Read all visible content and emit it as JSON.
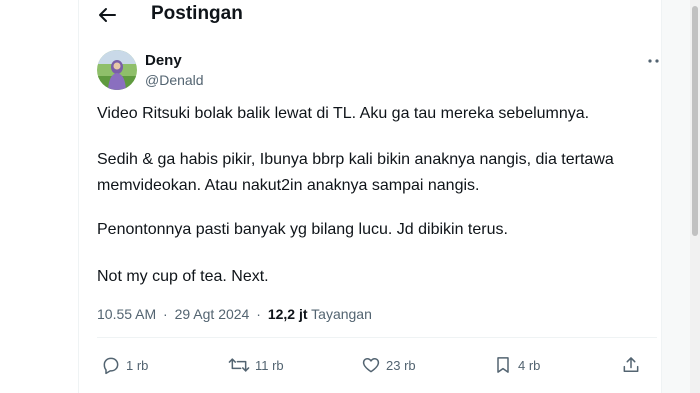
{
  "header": {
    "title": "Postingan"
  },
  "author": {
    "name": "Deny",
    "handle": "@Denald"
  },
  "tweet": {
    "paragraph1": "Video Ritsuki bolak balik lewat di TL. Aku ga tau mereka sebelumnya.",
    "paragraph2_line1": "Sedih & ga habis pikir, Ibunya bbrp kali bikin anaknya nangis, dia tertawa",
    "paragraph2_line2": "memvideokan. Atau nakut2in anaknya sampai nangis.",
    "paragraph3": "Penontonnya pasti banyak yg bilang lucu. Jd dibikin terus.",
    "paragraph4": "Not my cup of tea. Next."
  },
  "meta": {
    "time": "10.55 AM",
    "date": "29 Agt 2024",
    "separator": "·",
    "views_count": "12,2 jt",
    "views_label": "Tayangan"
  },
  "actions": {
    "reply_count": "1 rb",
    "repost_count": "11 rb",
    "like_count": "23 rb",
    "bookmark_count": "4 rb"
  },
  "icons": [
    "back-arrow-icon",
    "more-icon",
    "reply-icon",
    "repost-icon",
    "like-icon",
    "bookmark-icon",
    "share-icon"
  ],
  "colors": {
    "text": "#0f1419",
    "secondary": "#536471",
    "divider": "#eff3f4"
  }
}
